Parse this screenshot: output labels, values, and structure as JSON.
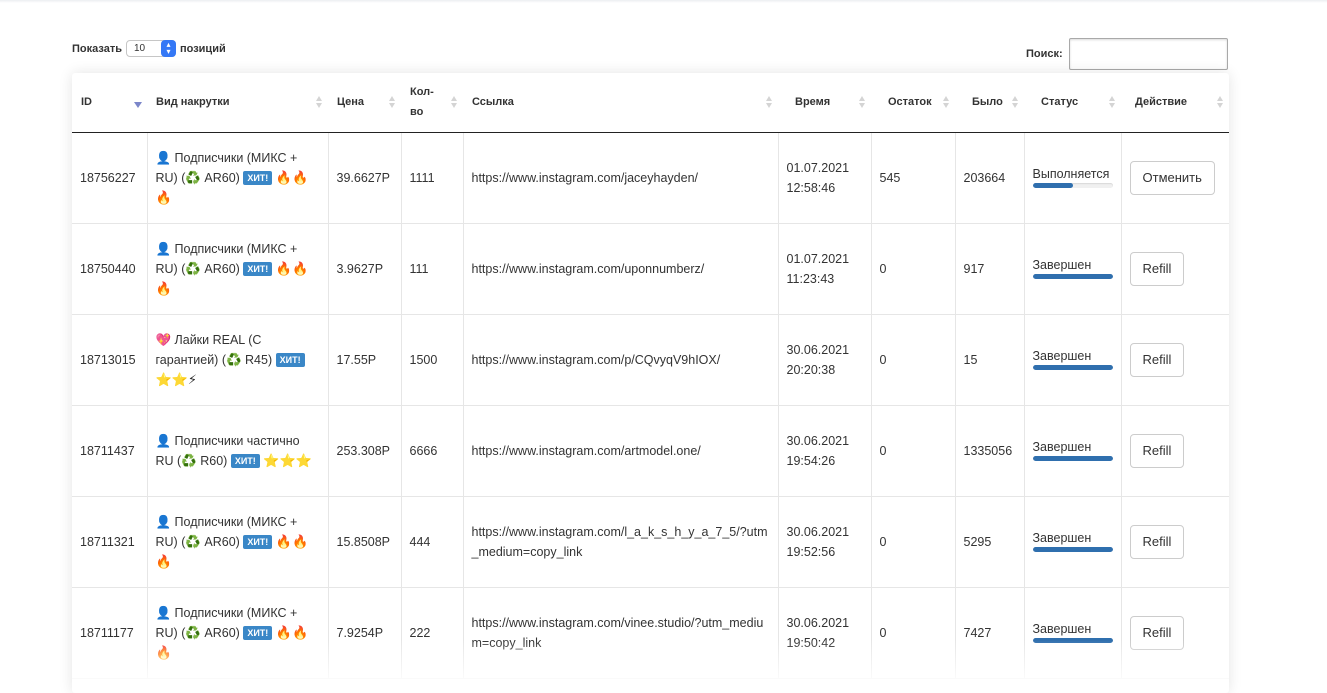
{
  "length_control": {
    "show_label": "Показать",
    "value": "10",
    "suffix": "позиций"
  },
  "search": {
    "label": "Поиск:",
    "placeholder": "",
    "value": ""
  },
  "columns": [
    "ID",
    "Вид накрутки",
    "Цена",
    "Кол-во",
    "Ссылка",
    "Время",
    "Остаток",
    "Было",
    "Статус",
    "Действие"
  ],
  "sort": {
    "column": "ID",
    "direction": "desc"
  },
  "hit_badge": "ХИТ!",
  "colors": {
    "badge": "#3a87c7",
    "progress": "#2f6fae",
    "sort_active": "#7b86c9"
  },
  "rows": [
    {
      "id": "18756227",
      "service_pre": "👤 Подписчики (МИКС + RU) (♻️ AR60)",
      "service_post": "🔥🔥🔥",
      "price": "39.6627Р",
      "qty": "1111",
      "link": "https://www.instagram.com/jaceyhayden/",
      "date": "01.07.2021",
      "time": "12:58:46",
      "remains": "545",
      "start": "203664",
      "status": "Выполняется",
      "progress": 0.5,
      "action": "Отменить"
    },
    {
      "id": "18750440",
      "service_pre": "👤 Подписчики (МИКС + RU) (♻️ AR60)",
      "service_post": "🔥🔥🔥",
      "price": "3.9627Р",
      "qty": "111",
      "link": "https://www.instagram.com/uponnumberz/",
      "date": "01.07.2021",
      "time": "11:23:43",
      "remains": "0",
      "start": "917",
      "status": "Завершен",
      "progress": 1,
      "action": "Refill"
    },
    {
      "id": "18713015",
      "service_pre": "💖 Лайки REAL (С гарантией) (♻️ R45)",
      "service_post": "⭐⭐⚡",
      "price": "17.55Р",
      "qty": "1500",
      "link": "https://www.instagram.com/p/CQvyqV9hIOX/",
      "date": "30.06.2021",
      "time": "20:20:38",
      "remains": "0",
      "start": "15",
      "status": "Завершен",
      "progress": 1,
      "action": "Refill"
    },
    {
      "id": "18711437",
      "service_pre": "👤 Подписчики частично RU (♻️ R60)",
      "service_post": "⭐⭐⭐",
      "price": "253.308Р",
      "qty": "6666",
      "link": "https://www.instagram.com/artmodel.one/",
      "date": "30.06.2021",
      "time": "19:54:26",
      "remains": "0",
      "start": "1335056",
      "status": "Завершен",
      "progress": 1,
      "action": "Refill"
    },
    {
      "id": "18711321",
      "service_pre": "👤 Подписчики (МИКС + RU) (♻️ AR60)",
      "service_post": "🔥🔥🔥",
      "price": "15.8508Р",
      "qty": "444",
      "link": "https://www.instagram.com/l_a_k_s_h_y_a_7_5/?utm_medium=copy_link",
      "date": "30.06.2021",
      "time": "19:52:56",
      "remains": "0",
      "start": "5295",
      "status": "Завершен",
      "progress": 1,
      "action": "Refill"
    },
    {
      "id": "18711177",
      "service_pre": "👤 Подписчики (МИКС + RU) (♻️ AR60)",
      "service_post": "🔥🔥🔥",
      "price": "7.9254Р",
      "qty": "222",
      "link": "https://www.instagram.com/vinee.studio/?utm_medium=copy_link",
      "date": "30.06.2021",
      "time": "19:50:42",
      "remains": "0",
      "start": "7427",
      "status": "Завершен",
      "progress": 1,
      "action": "Refill"
    }
  ]
}
